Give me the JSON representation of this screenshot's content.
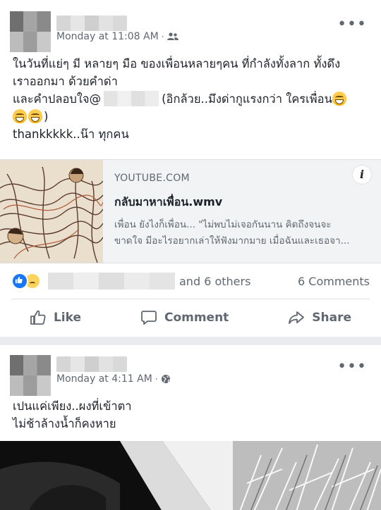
{
  "post1": {
    "timestamp": "Monday at 11:08 AM",
    "audience_icon": "friends-icon",
    "text_lines": [
      "ในวันที่แย่ๆ มี หลายๆ มือ ของเพื่อนหลายๆคน ที่กำลังทั้งลาก ทั้งดึง",
      "เราออกมา ด้วยคำด่า",
      "และคำปลอบใจ@",
      "(อิกล้วย..มึงด่ากูแรงกว่า ใครเพื่อน",
      ")",
      "thankkkkk..น๊า  ทุกคน"
    ],
    "link": {
      "domain": "YOUTUBE.COM",
      "title": "กลับมาหาเพื่อน.wmv",
      "desc_line1": "เพื่อน ยังไงก็เพื่อน... \"ไม่พบไม่เจอกันนาน คิดถึงจนจะ",
      "desc_line2": "ขาดใจ มีอะไรอยากเล่าให้ฟังมากมาย เมื่อฉันและเธอจา...",
      "info_glyph": "i"
    },
    "reactions": {
      "others": "and 6 others",
      "comments": "6 Comments"
    },
    "actions": {
      "like": "Like",
      "comment": "Comment",
      "share": "Share"
    }
  },
  "post2": {
    "timestamp": "Monday at 4:11 AM",
    "audience_icon": "globe-icon",
    "text_lines": [
      "เปนแค่เพียง..ผงที่เข้าตา",
      "ไม่ช้าล้างน้ำก็คงหาย"
    ]
  },
  "more_glyph": "•••",
  "colors": {
    "background": "#e9ebee",
    "card": "#ffffff",
    "text": "#1d2129",
    "secondary": "#606770",
    "like_blue": "#1877f2"
  }
}
